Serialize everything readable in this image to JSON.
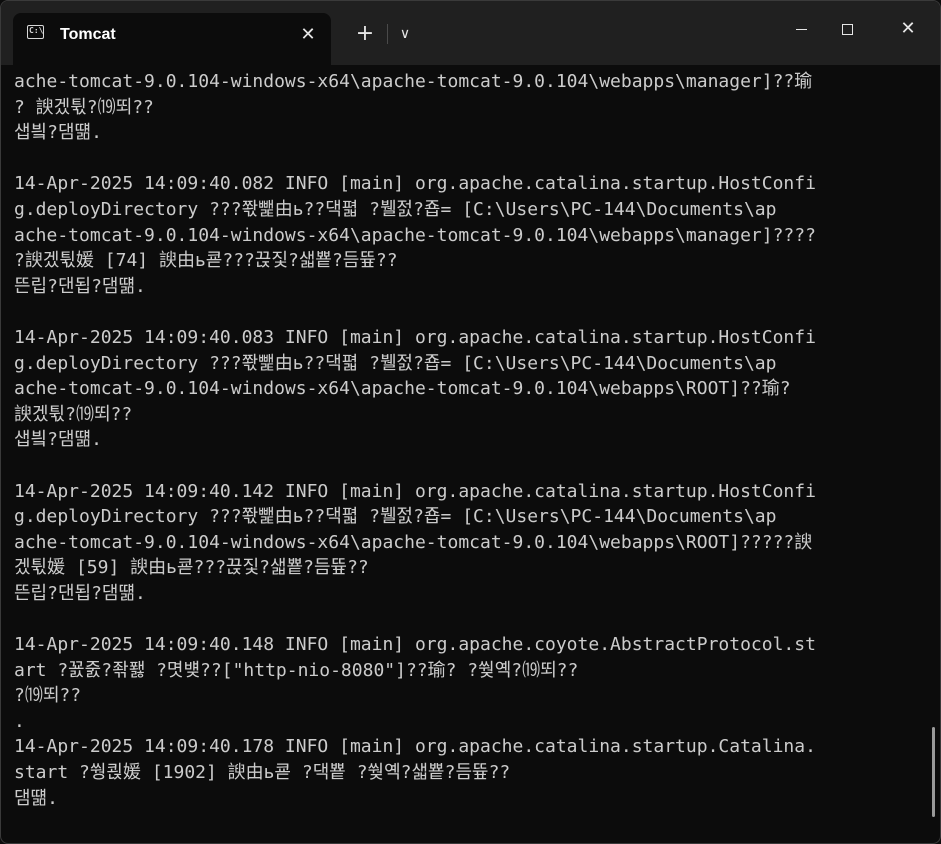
{
  "tab": {
    "title": "Tomcat",
    "icon": "terminal-icon",
    "icon_glyph": "C:\\",
    "close_glyph": "✕"
  },
  "toolbar": {
    "new_tab_glyph": "+",
    "dropdown_glyph": "∨"
  },
  "window_controls": {
    "minimize": "minimize-icon",
    "maximize": "maximize-icon",
    "close_glyph": "✕"
  },
  "terminal": {
    "lines": [
      "ache-tomcat-9.0.104-windows-x64\\apache-tomcat-9.0.104\\webapps\\manager]??瑜",
      "? 諛겠튃?⒆뙤??",
      "샙빀?댐떎.",
      "",
      "14-Apr-2025 14:09:40.082 INFO [main] org.apache.catalina.startup.HostConfi",
      "g.deployDirectory ???쫛뺉由ь??댁펿 ?뷀젌?죱= [C:\\Users\\PC-144\\Documents\\ap",
      "ache-tomcat-9.0.104-windows-x64\\apache-tomcat-9.0.104\\webapps\\manager]????",
      "?諛겠튃媛 [74] 諛由ь쿋???끉짗?샓뿉?듬뜦??",
      "뜬립?댄됩?댐떎.",
      "",
      "14-Apr-2025 14:09:40.083 INFO [main] org.apache.catalina.startup.HostConfi",
      "g.deployDirectory ???쫛뺉由ь??댁펿 ?뷀젌?죱= [C:\\Users\\PC-144\\Documents\\ap",
      "ache-tomcat-9.0.104-windows-x64\\apache-tomcat-9.0.104\\webapps\\ROOT]??瑜?",
      "諛겠튃?⒆뙤??",
      "샙빀?댐떎.",
      "",
      "14-Apr-2025 14:09:40.142 INFO [main] org.apache.catalina.startup.HostConfi",
      "g.deployDirectory ???쫛뺉由ь??댁펿 ?뷀젌?죱= [C:\\Users\\PC-144\\Documents\\ap",
      "ache-tomcat-9.0.104-windows-x64\\apache-tomcat-9.0.104\\webapps\\ROOT]?????諛",
      "겠튃媛 [59] 諛由ь쿋???끉짗?샓뿉?듬뜦??",
      "뜬립?댄됩?댐떎.",
      "",
      "14-Apr-2025 14:09:40.148 INFO [main] org.apache.coyote.AbstractProtocol.st",
      "art ?꾨줈?좎퐳 ?몃뱾??[\"http-nio-8080\"]??瑜? ?쒖옉?⒆뙤??",
      "?⒆뙤??",
      ".",
      "14-Apr-2025 14:09:40.178 INFO [main] org.apache.catalina.startup.Catalina.",
      "start ?쒕쾭媛 [1902] 諛由ь쿋 ?댁뿉 ?쒖옉?샓뿉?듬뜦??",
      "댐떎."
    ]
  },
  "colors": {
    "terminal_bg": "#0c0c0c",
    "titlebar_bg": "#202020",
    "text": "#cccccc"
  }
}
